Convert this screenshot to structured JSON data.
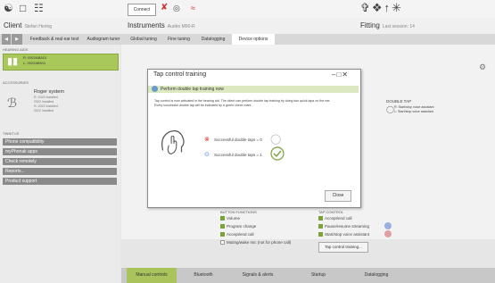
{
  "toolbar": {
    "connect_label": "Connect",
    "icons": [
      "hearing-aids-icon",
      "folder-icon",
      "open-icon",
      "mute-icon",
      "program-icon",
      "wireless-icon",
      "settings-icon"
    ]
  },
  "header": {
    "client_label": "Client",
    "client_sub": "Stefan Hering",
    "instruments_label": "Instruments",
    "instruments_sub": "Audéo M90-R",
    "fitting_label": "Fitting",
    "fitting_sub": "Last session: 14"
  },
  "nav": {
    "back_label": "Feedback & real ear test",
    "tabs": [
      "Audiogram tuner",
      "Global tuning",
      "Fine tuning",
      "Datalogging",
      "Device options"
    ],
    "active_tab": "Device options"
  },
  "sidebar": {
    "hearing_aids_label": "HEARING AIDS",
    "device_lines": [
      "R: 0922AB810",
      "L: 0922AB911"
    ],
    "accessories_label": "ACCESSORIES",
    "accessory_lines": [
      "Roger system",
      "R: 2022 installed",
      "2022 installed",
      "R: 2022 installed",
      "2022 installed"
    ],
    "tinnitus_label": "TINNITUS",
    "items": [
      "Phone compatibility",
      "myPhonak apps",
      "Check remotely",
      "Reports...",
      "Product support"
    ]
  },
  "main": {
    "double_tap_label": "DOUBLE TAP",
    "double_tap_lines": [
      "R: Start/stop voice assistant",
      "L: Start/stop voice assistant"
    ],
    "button_functions_label": "BUTTON FUNCTIONS",
    "button_functions": [
      "Volume",
      "Program change",
      "Accept/end call",
      "Muting/wake mic (not for phone call)"
    ],
    "tap_control_label": "TAP CONTROL",
    "tap_control": [
      "Accept/end call",
      "Pause/resume streaming",
      "Start/stop voice assistant"
    ],
    "tap_training_button": "Tap control training..."
  },
  "dialog": {
    "title": "Tap control training",
    "banner": "Perform double tap training now",
    "paragraph": "Tap control is now activated in the hearing aid. The client can perform double tap training by doing two quick taps on the ear. Every successful double tap will be indicated by a green check mark.",
    "result_1": "Successful double taps = 0",
    "result_2": "Successful double taps = 1",
    "close_label": "Close"
  },
  "bottom_tabs": [
    "Manual controls",
    "Bluetooth",
    "Signals & alerts",
    "Startup",
    "Datalogging"
  ],
  "active_bottom_tab": "Manual controls",
  "colors": {
    "accent_green": "#a9c45a",
    "check_green": "#7aa23a",
    "banner_green": "#dce9c0",
    "error_red": "#c33"
  }
}
